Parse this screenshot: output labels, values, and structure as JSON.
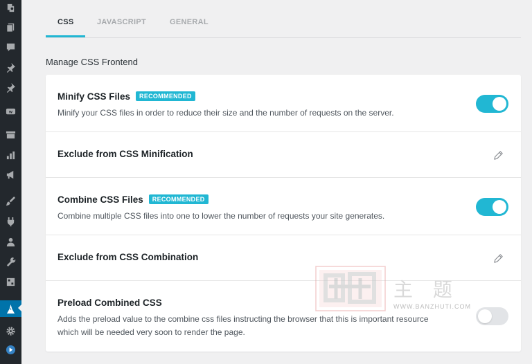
{
  "sidebar": {
    "icons": [
      "dashboard-icon",
      "pages-icon",
      "comments-icon",
      "pin-icon",
      "pin-icon",
      "woocommerce-icon",
      "archive-icon",
      "analytics-icon",
      "marketing-icon",
      "appearance-icon",
      "plugins-icon",
      "users-icon",
      "tools-icon",
      "settings-icon",
      "performance-plugin-icon",
      "gear-icon",
      "play-icon"
    ]
  },
  "tabs": [
    {
      "label": "CSS",
      "active": true
    },
    {
      "label": "JAVASCRIPT",
      "active": false
    },
    {
      "label": "GENERAL",
      "active": false
    }
  ],
  "section_title": "Manage CSS Frontend",
  "rows": [
    {
      "title": "Minify CSS Files",
      "badge": "RECOMMENDED",
      "description": "Minify your CSS files in order to reduce their size and the number of requests on the server.",
      "control": "toggle",
      "enabled": true
    },
    {
      "title": "Exclude from CSS Minification",
      "control": "edit"
    },
    {
      "title": "Combine CSS Files",
      "badge": "RECOMMENDED",
      "description": "Combine multiple CSS files into one to lower the number of requests your site generates.",
      "control": "toggle",
      "enabled": true
    },
    {
      "title": "Exclude from CSS Combination",
      "control": "edit"
    },
    {
      "title": "Preload Combined CSS",
      "description_line1": "Adds the preload value to the combine css files instructing the browser that this is important resource",
      "description_line2": "which will be needed very soon to render the page.",
      "control": "toggle",
      "enabled": false
    }
  ],
  "watermark": {
    "text": "主 题",
    "subtext": "WWW.BANZHUTI.COM"
  },
  "colors": {
    "accent": "#21b7d3",
    "sidebar": "#23282d",
    "active_menu": "#0073aa"
  }
}
